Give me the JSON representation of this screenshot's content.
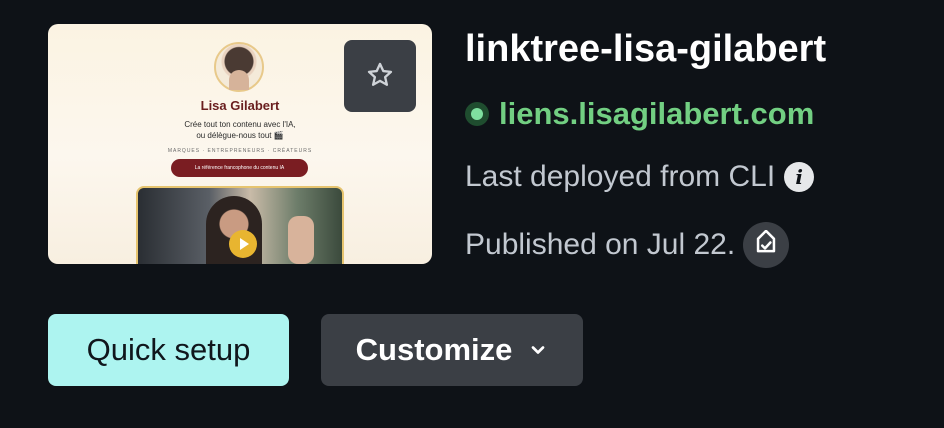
{
  "site": {
    "name": "linktree-lisa-gilabert",
    "url": "liens.lisagilabert.com",
    "deploy_text": "Last deployed from CLI",
    "published_text": "Published on Jul 22.",
    "status_color": "#72cf82"
  },
  "preview": {
    "profile_name": "Lisa Gilabert",
    "tagline_line1": "Crée tout ton contenu avec l'IA,",
    "tagline_line2": "ou délègue-nous tout 🎬",
    "categories": "MARQUES · ENTREPRENEURS · CRÉATEURS",
    "cta": "La référence francophone du contenu IA"
  },
  "actions": {
    "quick_setup_label": "Quick setup",
    "customize_label": "Customize"
  },
  "icons": {
    "favorite": "star-icon",
    "status": "status-dot-icon",
    "info": "info-icon",
    "badge": "verified-badge-icon",
    "dropdown": "chevron-down-icon"
  },
  "colors": {
    "background": "#0e1217",
    "accent_button": "#adf4f0",
    "secondary_button": "#3b3f45"
  }
}
